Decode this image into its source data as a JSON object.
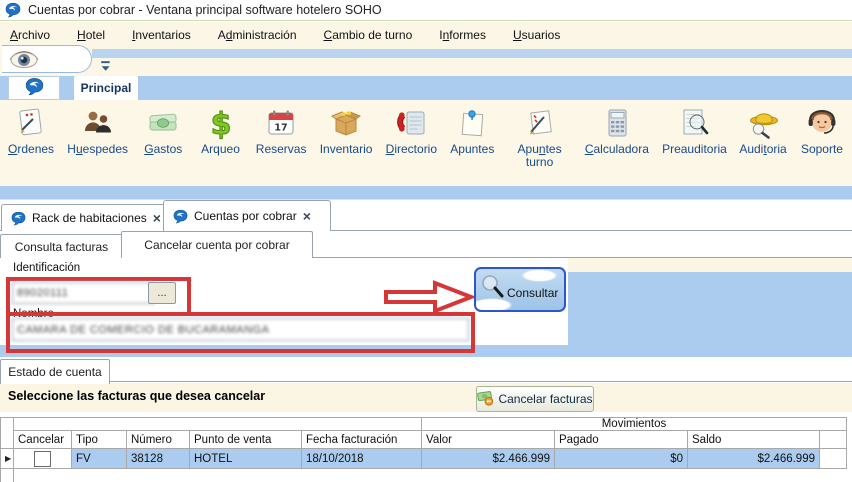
{
  "window": {
    "title": "Cuentas por cobrar - Ventana principal software hotelero SOHO",
    "icon": "soho-logo-icon"
  },
  "menu": {
    "items": [
      {
        "label": "Archivo",
        "u": 0
      },
      {
        "label": "Hotel",
        "u": 0
      },
      {
        "label": "Inventarios",
        "u": 0
      },
      {
        "label": "Administración",
        "u": 1
      },
      {
        "label": "Cambio de turno",
        "u": 0
      },
      {
        "label": "Informes",
        "u": 1
      },
      {
        "label": "Usuarios",
        "u": 0
      }
    ]
  },
  "qat": {
    "eye_icon": "eye-icon",
    "dropdown_icon": "chevron-down-icon"
  },
  "ribbon": {
    "app_icon": "soho-logo-icon",
    "tab": "Principal"
  },
  "toolbar": {
    "items": [
      {
        "label": "Ordenes",
        "u": 0,
        "icon": "ordenes-icon"
      },
      {
        "label": "Huespedes",
        "u": 1,
        "icon": "huespedes-icon"
      },
      {
        "label": "Gastos",
        "u": 0,
        "icon": "gastos-icon"
      },
      {
        "label": "Arqueo",
        "u": null,
        "icon": "arqueo-icon"
      },
      {
        "label": "Reservas",
        "u": null,
        "icon": "reservas-icon"
      },
      {
        "label": "Inventario",
        "u": null,
        "icon": "inventario-icon"
      },
      {
        "label": "Directorio",
        "u": 0,
        "icon": "directorio-icon"
      },
      {
        "label": "Apuntes",
        "u": null,
        "icon": "apuntes-icon"
      },
      {
        "label": "Apuntes turno",
        "u": 3,
        "icon": "apuntes-turno-icon"
      },
      {
        "label": "Calculadora",
        "u": 0,
        "icon": "calculadora-icon"
      },
      {
        "label": "Preauditoria",
        "u": null,
        "icon": "preauditoria-icon"
      },
      {
        "label": "Auditoria",
        "u": 4,
        "icon": "auditoria-icon"
      },
      {
        "label": "Soporte",
        "u": null,
        "icon": "soporte-icon"
      }
    ]
  },
  "doc_tabs": [
    {
      "label": "Rack de habitaciones",
      "icon": "soho-logo-icon",
      "close_icon": "close-icon",
      "active": false
    },
    {
      "label": "Cuentas por cobrar",
      "icon": "soho-logo-icon",
      "close_icon": "close-icon",
      "active": true
    }
  ],
  "sub_tabs": [
    {
      "label": "Consulta facturas",
      "active": false
    },
    {
      "label": "Cancelar cuenta por cobrar",
      "active": true
    }
  ],
  "form": {
    "identificacion_label": "Identificación",
    "identificacion_value": "89020111",
    "identificacion_redacted": true,
    "browse_button": "...",
    "nombre_label": "Nombre",
    "nombre_value": "CAMARA DE COMERCIO DE BUCARAMANGA",
    "nombre_redacted": true,
    "consultar_button": "Consultar",
    "consultar_icon": "magnifier-icon",
    "annotation": "red boxes and red arrow highlighting identification fields and Consultar button"
  },
  "estado": {
    "label": "Estado de cuenta"
  },
  "actions": {
    "instruction": "Seleccione las facturas que desea cancelar",
    "cancelar_facturas_button": "Cancelar facturas",
    "cancelar_facturas_icon": "banknote-minus-icon"
  },
  "table": {
    "group_header": "Movimientos",
    "columns": [
      "Cancelar",
      "Tipo",
      "Número",
      "Punto de venta",
      "Fecha facturación",
      "Valor",
      "Pagado",
      "Saldo"
    ],
    "rows": [
      {
        "selected": true,
        "checked": false,
        "tipo": "FV",
        "numero": "38128",
        "punto_de_venta": "HOTEL",
        "fecha_facturacion": "18/10/2018",
        "valor": "$2.466.999",
        "pagado": "$0",
        "saldo": "$2.466.999"
      }
    ]
  },
  "colors": {
    "accent_blue": "#abccee",
    "cream": "#fbf6e6",
    "annotation_red": "#d63636",
    "row_highlight": "#abccee",
    "consultar_border": "#2f55cc",
    "toolbar_label_blue": "#174a8c"
  }
}
